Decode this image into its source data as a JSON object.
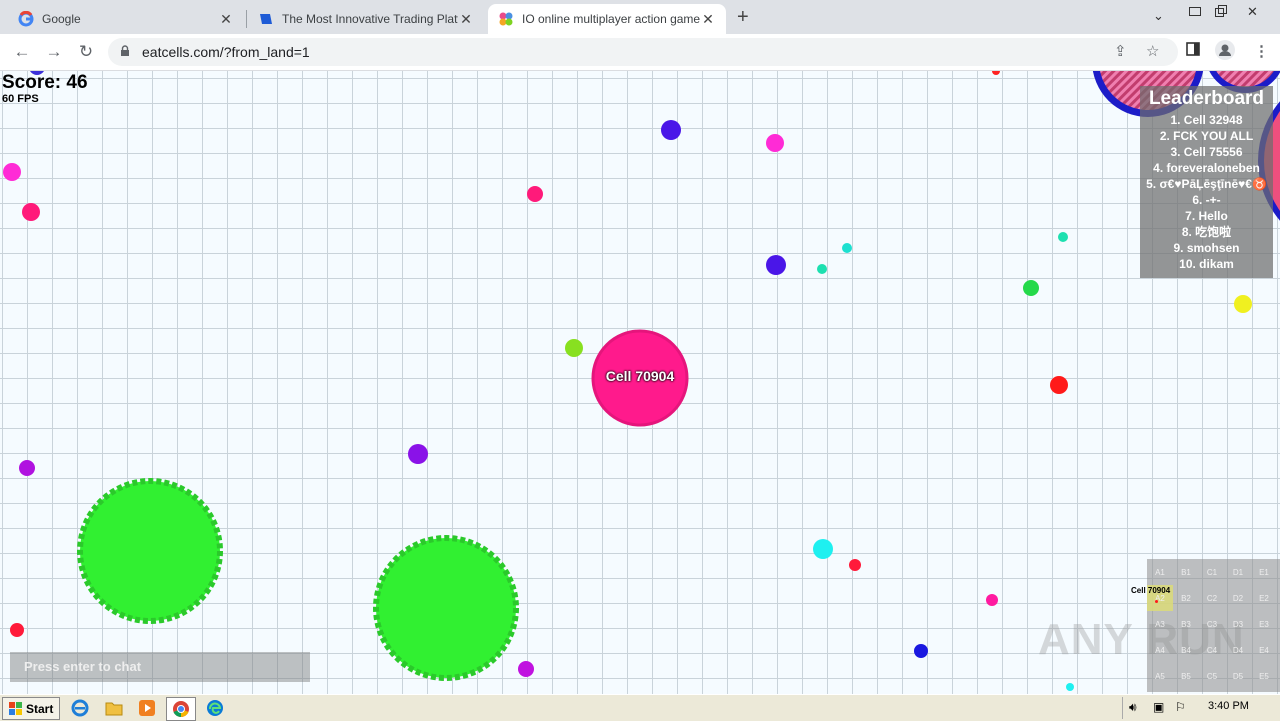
{
  "browser": {
    "tabs": [
      {
        "title": "Google",
        "icon": "google-icon",
        "active": false
      },
      {
        "title": "The Most Innovative Trading Platform",
        "icon": "trading-icon",
        "active": false
      },
      {
        "title": "IO online multiplayer action game. St",
        "icon": "game-icon",
        "active": true
      }
    ],
    "new_tab_symbol": "+",
    "url": "eatcells.com/?from_land=1"
  },
  "game": {
    "score_text": "Score: 46",
    "fps_text": "60 FPS",
    "player_cell_name": "Cell 70904",
    "player_color": "#ff1a8c",
    "leaderboard": {
      "title": "Leaderboard",
      "entries": [
        "1. Cell 32948",
        "2. FCK YOU ALL",
        "3. Cell 75556",
        "4. foreveraloneben",
        "5. σ€♥PāĻēşţīnē♥€♉",
        "6. -+-",
        "7. Hello",
        "8. 吃饱啦",
        "9. smohsen",
        "10. dikam"
      ]
    },
    "chat_placeholder": "Press enter to chat",
    "minimap": {
      "cells": [
        [
          "A1",
          "B1",
          "C1",
          "D1",
          "E1"
        ],
        [
          "A2",
          "B2",
          "C2",
          "D2",
          "E2"
        ],
        [
          "A3",
          "B3",
          "C3",
          "D3",
          "E3"
        ],
        [
          "A4",
          "B4",
          "C4",
          "D4",
          "E4"
        ],
        [
          "A5",
          "B5",
          "C5",
          "D5",
          "E5"
        ]
      ],
      "player_label": "Cell 70904"
    },
    "watermark": "ANY RUN"
  },
  "taskbar": {
    "start_label": "Start",
    "clock": "3:40 PM"
  }
}
